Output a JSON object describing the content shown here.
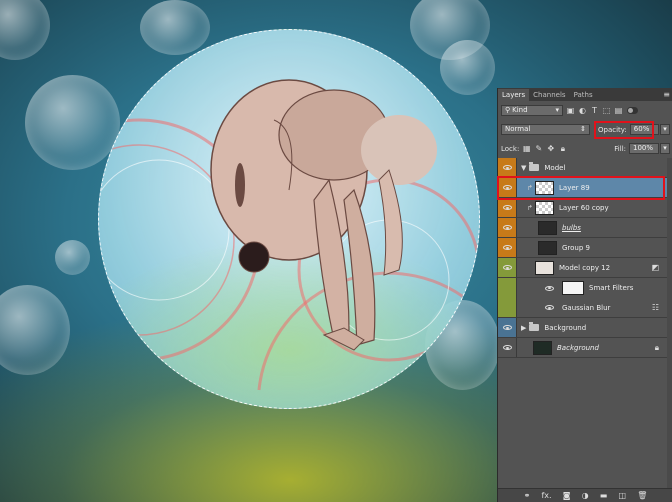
{
  "layers_panel": {
    "tabs": [
      "Layers",
      "Channels",
      "Paths"
    ],
    "filter_kind": "Kind",
    "blend_mode": "Normal",
    "opacity_label": "Opacity:",
    "opacity_value": "60%",
    "lock_label": "Lock:",
    "fill_label": "Fill:",
    "fill_value": "100%",
    "layers": [
      {
        "name": "Model",
        "type": "group",
        "label_color": "#c77a19",
        "expanded": true
      },
      {
        "name": "Layer 89",
        "type": "layer",
        "label_color": "#c77a19",
        "selected": true
      },
      {
        "name": "Layer 60 copy",
        "type": "layer",
        "label_color": "#c77a19"
      },
      {
        "name": "bulbs",
        "type": "layer",
        "label_color": "#c77a19"
      },
      {
        "name": "Group 9",
        "type": "layer",
        "label_color": "#c77a19"
      },
      {
        "name": "Model copy 12",
        "type": "smart-object",
        "label_color": "#849a3a"
      },
      {
        "name": "Smart Filters",
        "type": "filter-mask",
        "label_color": "#849a3a"
      },
      {
        "name": "Gaussian Blur",
        "type": "filter",
        "label_color": "#849a3a"
      },
      {
        "name": "Background",
        "type": "group",
        "label_color": "#4a7393"
      },
      {
        "name": "Background",
        "type": "background",
        "label_color": "#535353"
      }
    ],
    "bottom_icons": [
      "link-icon",
      "fx-icon",
      "mask-icon",
      "adjustment-icon",
      "folder-icon",
      "new-layer-icon",
      "trash-icon"
    ],
    "fx_label": "fx."
  },
  "colors": {
    "highlight_red": "#e0121b",
    "selected_row": "#5e87a9",
    "panel_bg": "#535353"
  }
}
